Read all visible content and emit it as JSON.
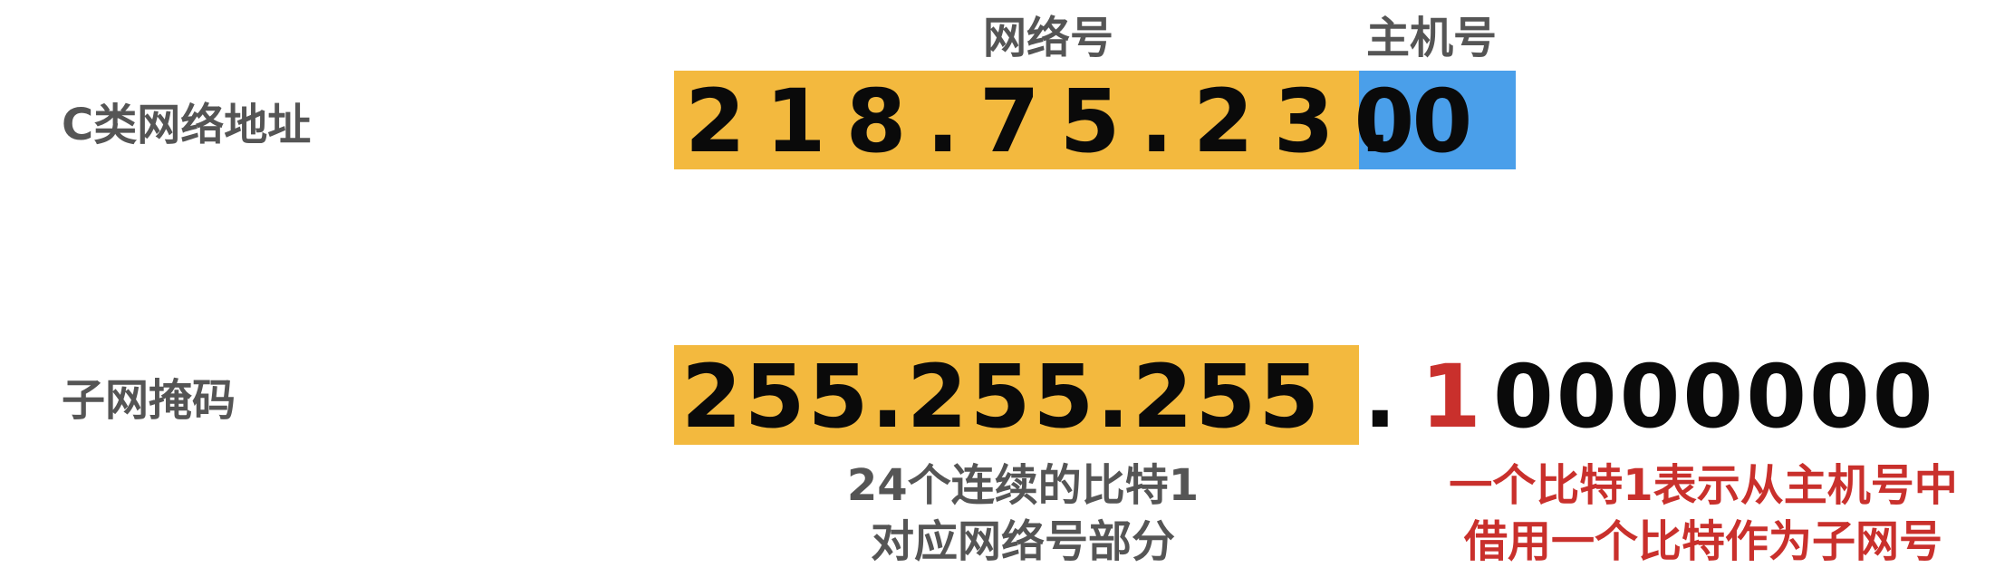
{
  "colors": {
    "network_part": "#F3B93E",
    "host_part": "#4A9FEA",
    "borrowed_bit": "#C9302C",
    "label_text": "#555555",
    "digits": "#0A0A0A"
  },
  "header": {
    "network_label": "网络号",
    "host_label": "主机号"
  },
  "address_row": {
    "row_label": "C类网络地址",
    "network_part": "218.75.230",
    "host_part": ".0"
  },
  "mask_row": {
    "row_label": "子网掩码",
    "network_part": "255.255.255",
    "dot": ".",
    "borrowed_bit": "1",
    "remaining_bits": "0000000"
  },
  "notes": {
    "left_line1": "24个连续的比特1",
    "left_line2": "对应网络号部分",
    "right_line1": "一个比特1表示从主机号中",
    "right_line2": "借用一个比特作为子网号"
  }
}
